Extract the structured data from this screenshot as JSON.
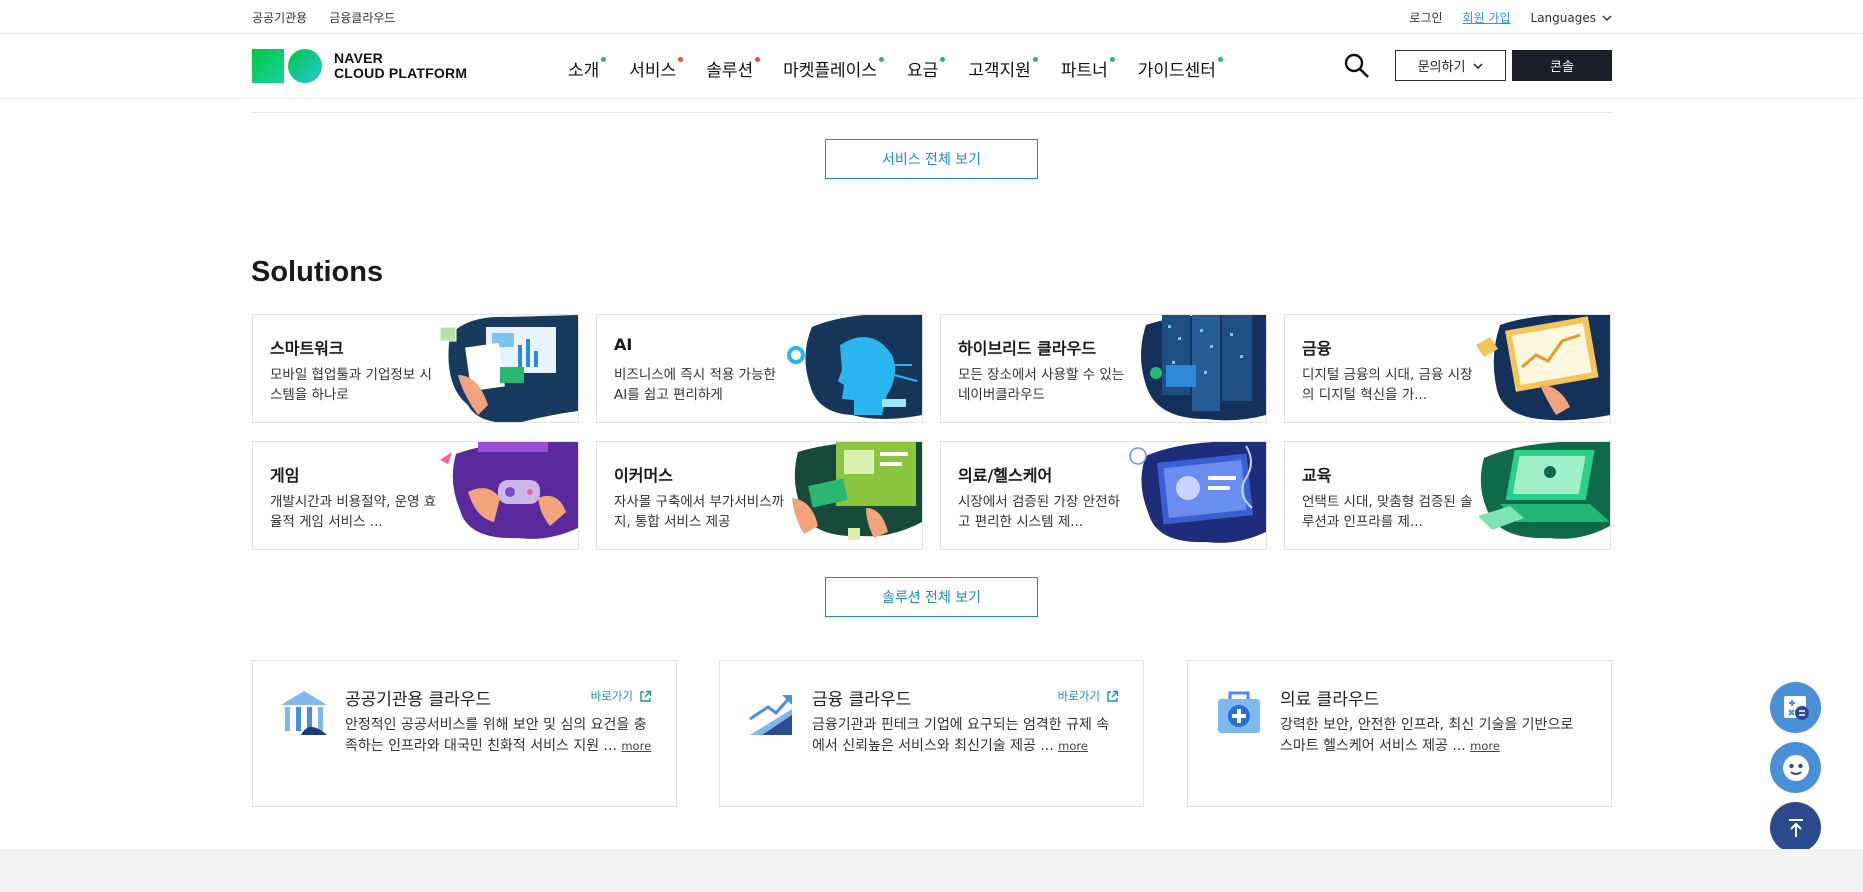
{
  "topbar": {
    "public_cloud": "공공기관용",
    "finance_cloud": "금융클라우드",
    "login": "로그인",
    "signup": "회원 가입",
    "languages": "Languages"
  },
  "header": {
    "logo_line1": "NAVER",
    "logo_line2": "CLOUD PLATFORM",
    "nav": [
      {
        "label": "소개",
        "dot": "#2bb673"
      },
      {
        "label": "서비스",
        "dot": "#ef4a3d"
      },
      {
        "label": "솔루션",
        "dot": "#ef4a3d"
      },
      {
        "label": "마켓플레이스",
        "dot": "#2bb673"
      },
      {
        "label": "요금",
        "dot": "#2bb673"
      },
      {
        "label": "고객지원",
        "dot": "#2bb673"
      },
      {
        "label": "파트너",
        "dot": "#2bb673"
      },
      {
        "label": "가이드센터",
        "dot": "#2bb673"
      }
    ],
    "inquiry": "문의하기",
    "console": "콘솔"
  },
  "services_button": "서비스 전체 보기",
  "solutions": {
    "title": "Solutions",
    "cards": [
      {
        "title": "스마트워크",
        "desc": "모바일 협업툴과 기업정보 시스템을 하나로"
      },
      {
        "title": "AI",
        "desc": "비즈니스에 즉시 적용 가능한 AI를 쉽고 편리하게"
      },
      {
        "title": "하이브리드 클라우드",
        "desc": "모든 장소에서 사용할 수 있는 네이버클라우드"
      },
      {
        "title": "금융",
        "desc": "디지털 금융의 시대, 금융 시장의 디지털 혁신을 가..."
      },
      {
        "title": "게임",
        "desc": "개발시간과 비용절약, 운영 효율적 게임 서비스 ..."
      },
      {
        "title": "이커머스",
        "desc": "자사몰 구축에서 부가서비스까지, 통합 서비스 제공"
      },
      {
        "title": "의료/헬스케어",
        "desc": "시장에서 검증된 가장 안전하고 편리한 시스템 제..."
      },
      {
        "title": "교육",
        "desc": "언택트 시대, 맞춤형 검증된 솔루션과 인프라를 제..."
      }
    ],
    "all_button": "솔루션 전체 보기"
  },
  "industry": [
    {
      "title": "공공기관용 클라우드",
      "link": "바로가기",
      "desc": "안정적인 공공서비스를 위해 보안 및 심의 요건을 충족하는 인프라와 대국민 친화적 서비스 지원 ...",
      "more": "more"
    },
    {
      "title": "금융 클라우드",
      "link": "바로가기",
      "desc": "금융기관과 핀테크 기업에 요구되는 엄격한 규제 속에서 신뢰높은 서비스와 최신기술 제공 ...",
      "more": "more"
    },
    {
      "title": "의료 클라우드",
      "desc": "강력한 보안, 안전한 인프라, 최신 기술을 기반으로 스마트 헬스케어 서비스 제공 ...",
      "more": "more"
    }
  ],
  "colors": {
    "accent": "#1e8fb7",
    "console_bg": "#1c1f27",
    "fab_light": "#4a90d9",
    "fab_dark": "#2c4a8f"
  }
}
